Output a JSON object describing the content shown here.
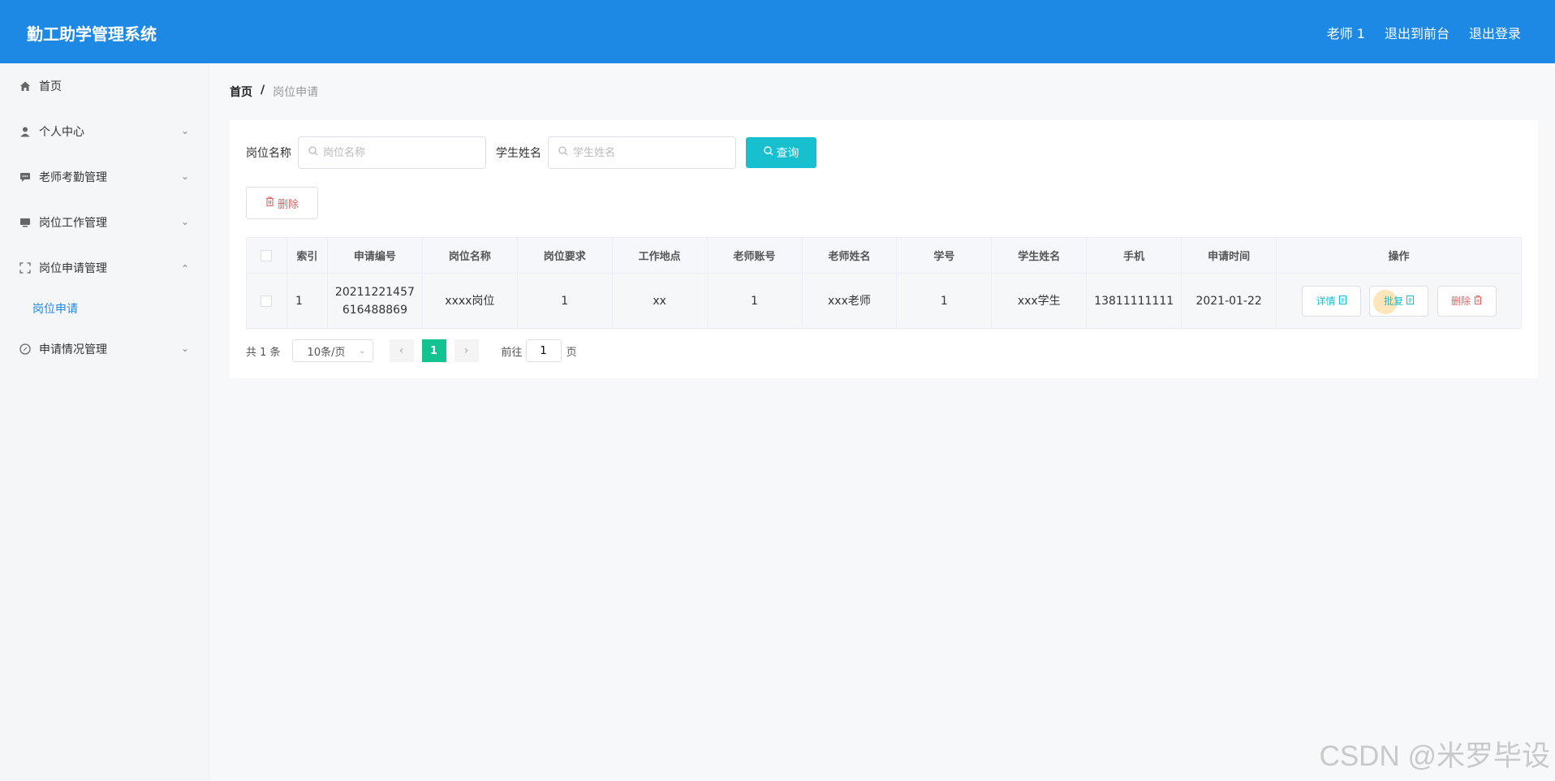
{
  "app": {
    "title": "勤工助学管理系统",
    "user": "老师 1",
    "exit_front": "退出到前台",
    "logout": "退出登录"
  },
  "sidebar": {
    "items": [
      {
        "label": "首页",
        "icon": "home-icon"
      },
      {
        "label": "个人中心",
        "icon": "user-icon"
      },
      {
        "label": "老师考勤管理",
        "icon": "chat-icon"
      },
      {
        "label": "岗位工作管理",
        "icon": "monitor-icon"
      },
      {
        "label": "岗位申请管理",
        "icon": "fullscreen-icon"
      },
      {
        "label": "申请情况管理",
        "icon": "compass-icon"
      }
    ],
    "sub_items": [
      {
        "label": "岗位申请"
      }
    ]
  },
  "breadcrumb": {
    "home": "首页",
    "separator": "/",
    "current": "岗位申请"
  },
  "search": {
    "position_label": "岗位名称",
    "position_placeholder": "岗位名称",
    "student_label": "学生姓名",
    "student_placeholder": "学生姓名",
    "query_button": "查询"
  },
  "toolbar": {
    "delete_label": "删除"
  },
  "table": {
    "headers": [
      "索引",
      "申请编号",
      "岗位名称",
      "岗位要求",
      "工作地点",
      "老师账号",
      "老师姓名",
      "学号",
      "学生姓名",
      "手机",
      "申请时间",
      "操作"
    ],
    "rows": [
      {
        "index": "1",
        "app_no_line1": "20211221457",
        "app_no_line2": "616488869",
        "position": "xxxx岗位",
        "requirement": "1",
        "location": "xx",
        "teacher_account": "1",
        "teacher_name": "xxx老师",
        "student_no": "1",
        "student_name": "xxx学生",
        "phone": "13811111111",
        "apply_time": "2021-01-22",
        "ops": {
          "detail": "详情",
          "approve": "批复",
          "delete": "删除"
        }
      }
    ]
  },
  "pager": {
    "total": "共 1 条",
    "page_size": "10条/页",
    "current_page": "1",
    "goto_prefix": "前往",
    "goto_value": "1",
    "goto_suffix": "页"
  },
  "watermark": "CSDN @米罗毕设",
  "colors": {
    "header_bg": "#1e88e5",
    "accent_cyan": "#17bfcf",
    "active_page": "#13c28f",
    "danger": "#e06363"
  }
}
